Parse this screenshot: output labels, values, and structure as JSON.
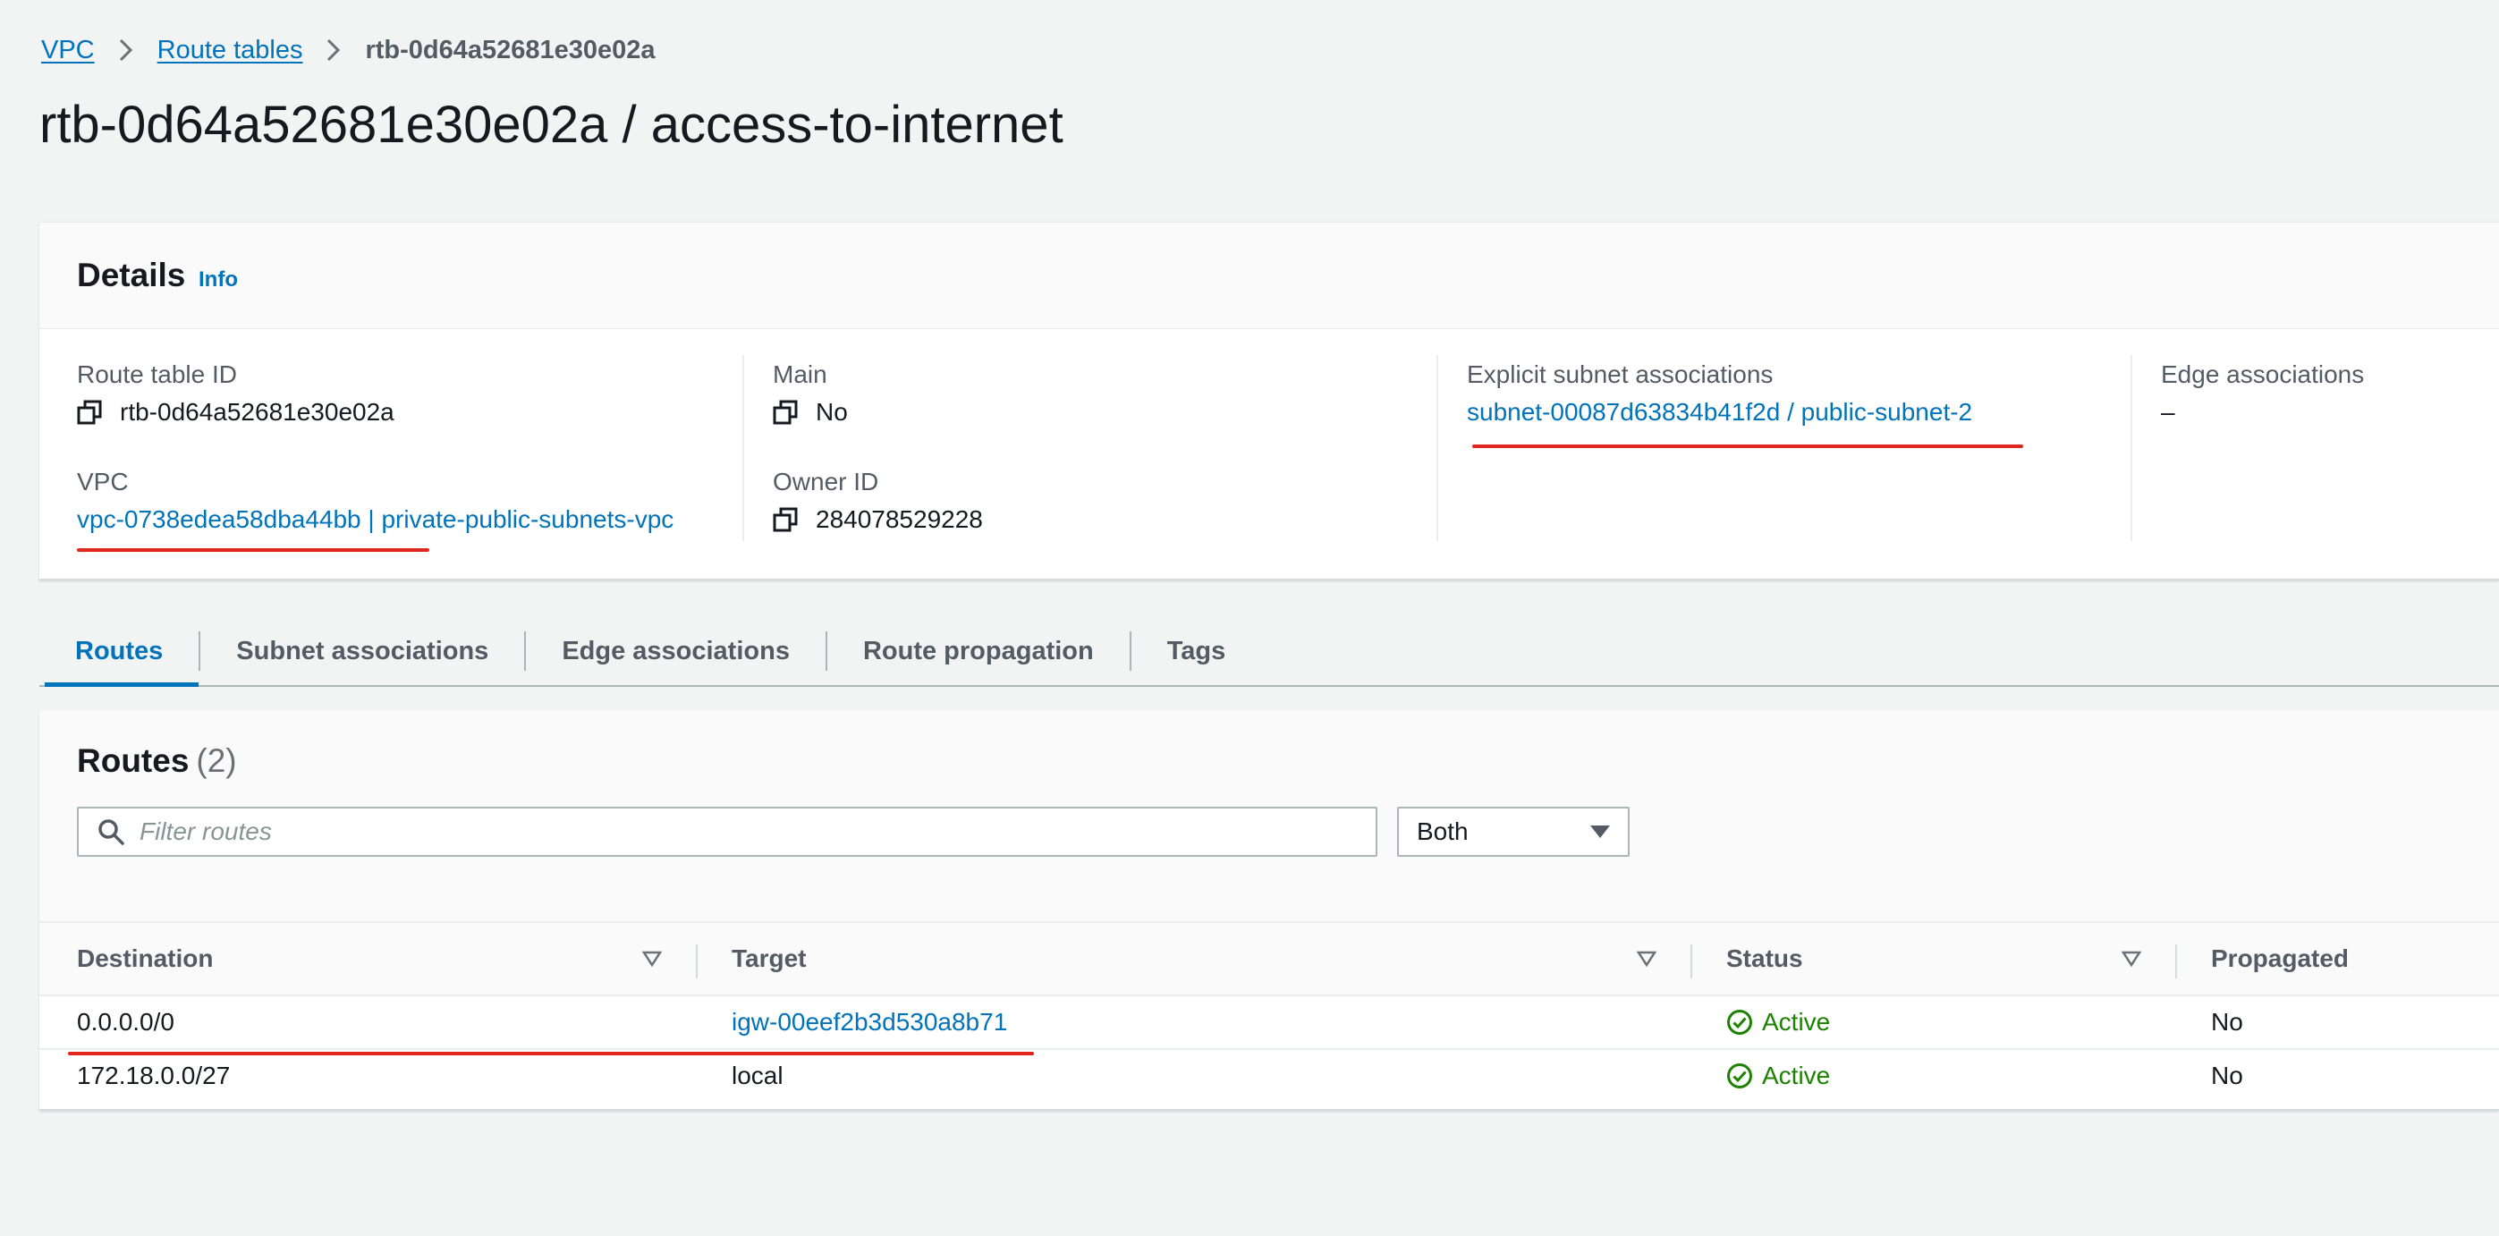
{
  "breadcrumb": {
    "items": [
      "VPC",
      "Route tables"
    ],
    "current": "rtb-0d64a52681e30e02a"
  },
  "page_title": "rtb-0d64a52681e30e02a / access-to-internet",
  "details": {
    "title": "Details",
    "info_label": "Info",
    "route_table_id": {
      "label": "Route table ID",
      "value": "rtb-0d64a52681e30e02a"
    },
    "main": {
      "label": "Main",
      "value": "No"
    },
    "explicit_subnet": {
      "label": "Explicit subnet associations",
      "value": "subnet-00087d63834b41f2d / public-subnet-2"
    },
    "edge": {
      "label": "Edge associations",
      "value": "–"
    },
    "vpc": {
      "label": "VPC",
      "value": "vpc-0738edea58dba44bb | private-public-subnets-vpc"
    },
    "owner": {
      "label": "Owner ID",
      "value": "284078529228"
    }
  },
  "tabs": [
    "Routes",
    "Subnet associations",
    "Edge associations",
    "Route propagation",
    "Tags"
  ],
  "active_tab": "Routes",
  "routes": {
    "title": "Routes",
    "count": "(2)",
    "filter_placeholder": "Filter routes",
    "select_value": "Both",
    "columns": [
      "Destination",
      "Target",
      "Status",
      "Propagated"
    ],
    "rows": [
      {
        "destination": "0.0.0.0/0",
        "target": "igw-00eef2b3d530a8b71",
        "target_is_link": true,
        "status": "Active",
        "propagated": "No"
      },
      {
        "destination": "172.18.0.0/27",
        "target": "local",
        "target_is_link": false,
        "status": "Active",
        "propagated": "No"
      }
    ]
  },
  "colors": {
    "link": "#0073bb",
    "active_status": "#1d8102",
    "highlight_underline": "#e0261d"
  }
}
